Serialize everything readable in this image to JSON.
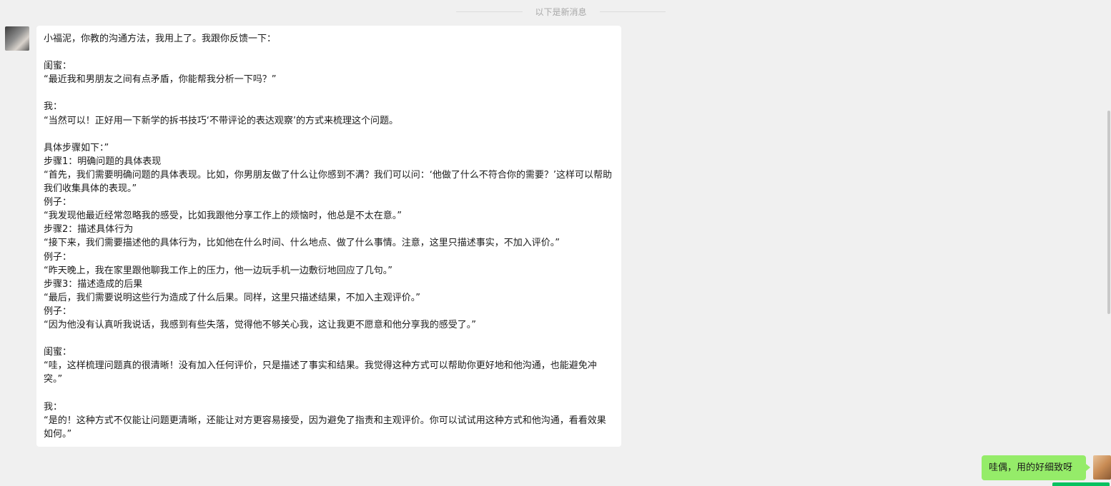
{
  "divider": {
    "text": "以下是新消息"
  },
  "messages": {
    "incoming": {
      "text": "小福泥，你教的沟通方法，我用上了。我跟你反馈一下：\n\n闺蜜：\n“最近我和男朋友之间有点矛盾，你能帮我分析一下吗？”\n\n我：\n“当然可以！正好用一下新学的拆书技巧‘不带评论的表达观察’的方式来梳理这个问题。\n\n具体步骤如下：”\n步骤1：明确问题的具体表现\n“首先，我们需要明确问题的具体表现。比如，你男朋友做了什么让你感到不满？我们可以问：‘他做了什么不符合你的需要？’这样可以帮助我们收集具体的表现。”\n例子：\n“我发现他最近经常忽略我的感受，比如我跟他分享工作上的烦恼时，他总是不太在意。”\n步骤2：描述具体行为\n“接下来，我们需要描述他的具体行为，比如他在什么时间、什么地点、做了什么事情。注意，这里只描述事实，不加入评价。”\n例子：\n“昨天晚上，我在家里跟他聊我工作上的压力，他一边玩手机一边敷衍地回应了几句。”\n步骤3：描述造成的后果\n“最后，我们需要说明这些行为造成了什么后果。同样，这里只描述结果，不加入主观评价。”\n例子：\n“因为他没有认真听我说话，我感到有些失落，觉得他不够关心我，这让我更不愿意和他分享我的感受了。”\n\n闺蜜：\n“哇，这样梳理问题真的很清晰！没有加入任何评价，只是描述了事实和结果。我觉得这种方式可以帮助你更好地和他沟通，也能避免冲突。”\n\n我：\n“是的！这种方式不仅能让问题更清晰，还能让对方更容易接受，因为避免了指责和主观评价。你可以试试用这种方式和他沟通，看看效果如何。”"
    },
    "outgoing": {
      "text": "哇偶，用的好细致呀"
    }
  },
  "colors": {
    "background": "#f0f0f0",
    "incoming_bubble": "#ffffff",
    "outgoing_bubble": "#95ec69",
    "accent_green": "#07c160"
  }
}
